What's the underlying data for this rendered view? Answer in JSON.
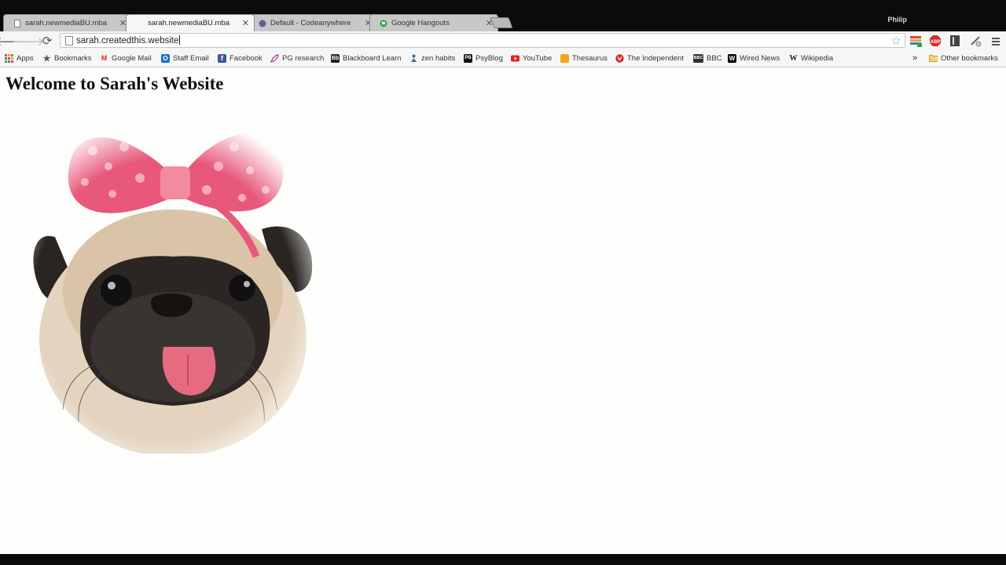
{
  "window": {
    "profile_name": "Philip"
  },
  "tabs": [
    {
      "title": "sarah.newmediaBU.mba",
      "icon": "page-icon",
      "active": false
    },
    {
      "title": "sarah.newmediaBU.mba",
      "icon": "none",
      "active": true
    },
    {
      "title": "Default - Codeanywhere",
      "icon": "codeanywhere-icon",
      "active": false
    },
    {
      "title": "Google Hangouts",
      "icon": "hangouts-icon",
      "active": false
    }
  ],
  "toolbar": {
    "url": "sarah.createdthis.website"
  },
  "bookmarks": {
    "items": [
      {
        "label": "Apps",
        "icon": "apps-grid-icon"
      },
      {
        "label": "Bookmarks",
        "icon": "star-icon"
      },
      {
        "label": "Google Mail",
        "icon": "gmail-icon"
      },
      {
        "label": "Staff Email",
        "icon": "outlook-icon"
      },
      {
        "label": "Facebook",
        "icon": "facebook-icon"
      },
      {
        "label": "PG research",
        "icon": "feather-icon"
      },
      {
        "label": "Blackboard Learn",
        "icon": "blackboard-icon"
      },
      {
        "label": "zen habits",
        "icon": "zen-icon"
      },
      {
        "label": "PsyBlog",
        "icon": "psyblog-icon"
      },
      {
        "label": "YouTube",
        "icon": "youtube-icon"
      },
      {
        "label": "Thesaurus",
        "icon": "thesaurus-icon"
      },
      {
        "label": "The Independent",
        "icon": "independent-icon"
      },
      {
        "label": "BBC",
        "icon": "bbc-icon"
      },
      {
        "label": "Wired News",
        "icon": "wired-icon"
      },
      {
        "label": "Wikipedia",
        "icon": "wikipedia-icon"
      }
    ],
    "overflow": "»",
    "other": "Other bookmarks"
  },
  "page": {
    "heading": "Welcome to Sarah's Website"
  },
  "colors": {
    "chrome_dark": "#0b0b0b",
    "tab_inactive": "#c8c8c8",
    "toolbar": "#f6f6f6",
    "bow_pink": "#e8587a"
  }
}
